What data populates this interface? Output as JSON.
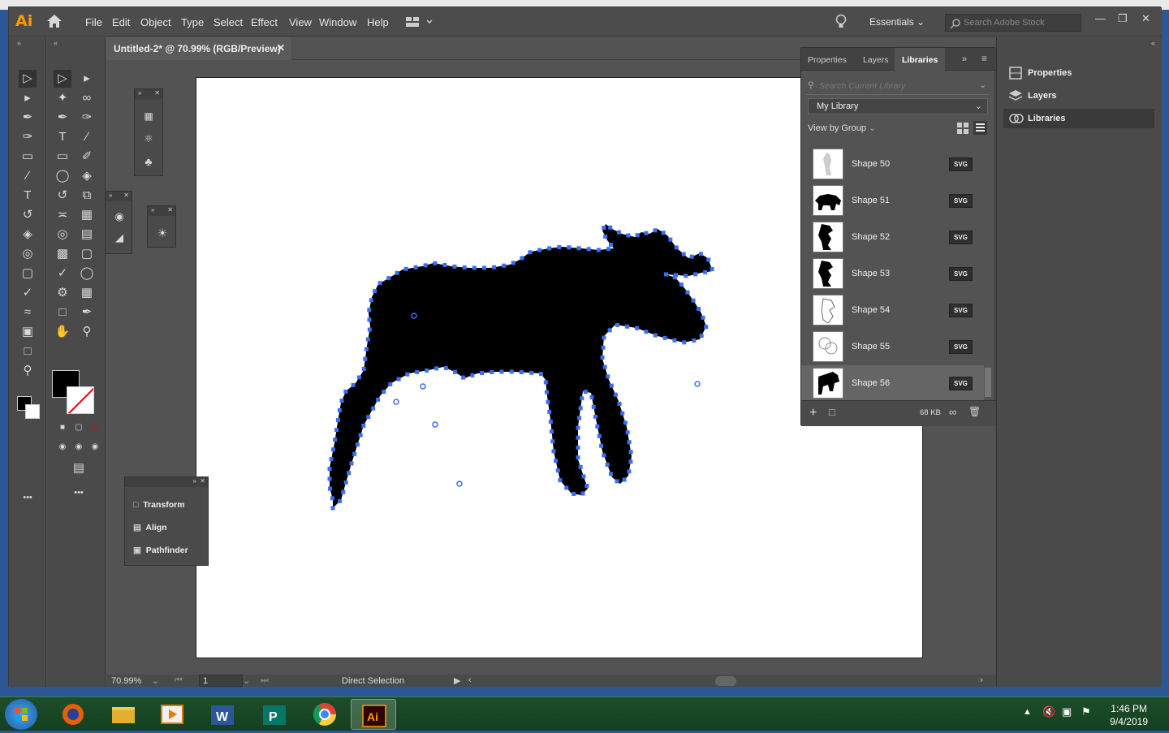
{
  "app": {
    "logo": "Ai",
    "menus": [
      "File",
      "Edit",
      "Object",
      "Type",
      "Select",
      "Effect",
      "View",
      "Window",
      "Help"
    ],
    "workspace": "Essentials",
    "stock_placeholder": "Search Adobe Stock"
  },
  "document": {
    "tab_title": "Untitled-2* @ 70.99% (RGB/Preview)",
    "zoom": "70.99%",
    "artboard_num": "1",
    "active_tool": "Direct Selection"
  },
  "floating_panels": {
    "transform": "Transform",
    "align": "Align",
    "pathfinder": "Pathfinder"
  },
  "libraries": {
    "tabs": [
      "Properties",
      "Layers",
      "Libraries"
    ],
    "search_placeholder": "Search Current Library",
    "library_name": "My Library",
    "view_by": "View by Group",
    "items": [
      {
        "name": "Shape 50",
        "type": "SVG"
      },
      {
        "name": "Shape 51",
        "type": "SVG"
      },
      {
        "name": "Shape 52",
        "type": "SVG"
      },
      {
        "name": "Shape 53",
        "type": "SVG"
      },
      {
        "name": "Shape 54",
        "type": "SVG"
      },
      {
        "name": "Shape 55",
        "type": "SVG"
      },
      {
        "name": "Shape 56",
        "type": "SVG"
      }
    ],
    "size": "68 KB"
  },
  "right_dock": {
    "items": [
      "Properties",
      "Layers",
      "Libraries"
    ]
  },
  "taskbar": {
    "time": "1:46 PM",
    "date": "9/4/2019"
  },
  "colors": {
    "anchor": "#3b6ef5",
    "ai_orange": "#ff9a00"
  }
}
